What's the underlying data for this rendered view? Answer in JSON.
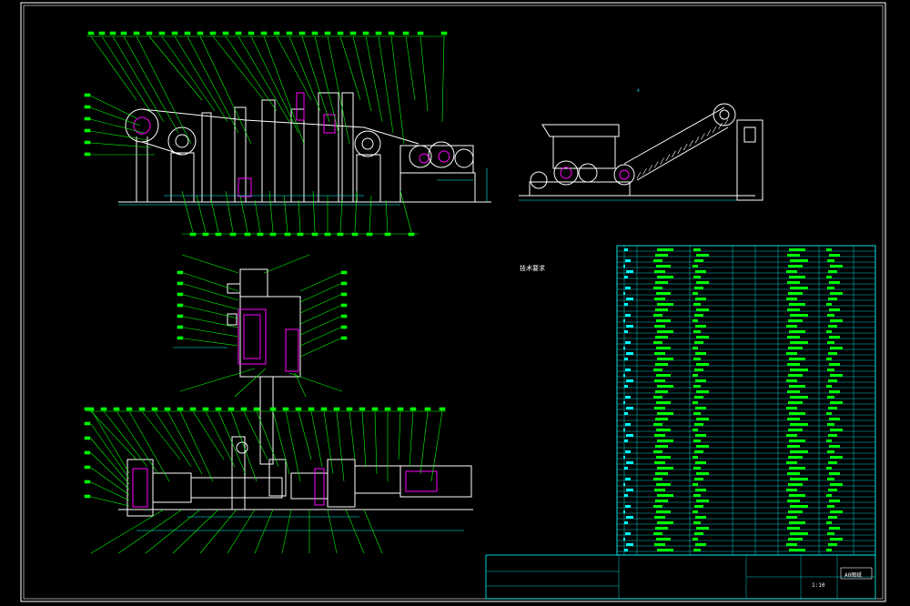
{
  "drawing": {
    "background": "#000000",
    "frame_color": "#ffffff",
    "leader_color": "#00ff00",
    "part_color": "#ffffff",
    "highlight_color": "#ff00ff",
    "table_color": "#00ffff",
    "dimension_color": "#00ffff"
  },
  "views": [
    {
      "id": "elevation",
      "icon": "production-line-elevation"
    },
    {
      "id": "side",
      "icon": "conveyor-side-view"
    },
    {
      "id": "section",
      "icon": "frame-section-view"
    },
    {
      "id": "plan",
      "icon": "roll-line-plan-view"
    }
  ],
  "notes": {
    "title": "技术要求"
  },
  "title_block": {
    "scale": "1:10",
    "drawing_no": "A0图纸"
  }
}
